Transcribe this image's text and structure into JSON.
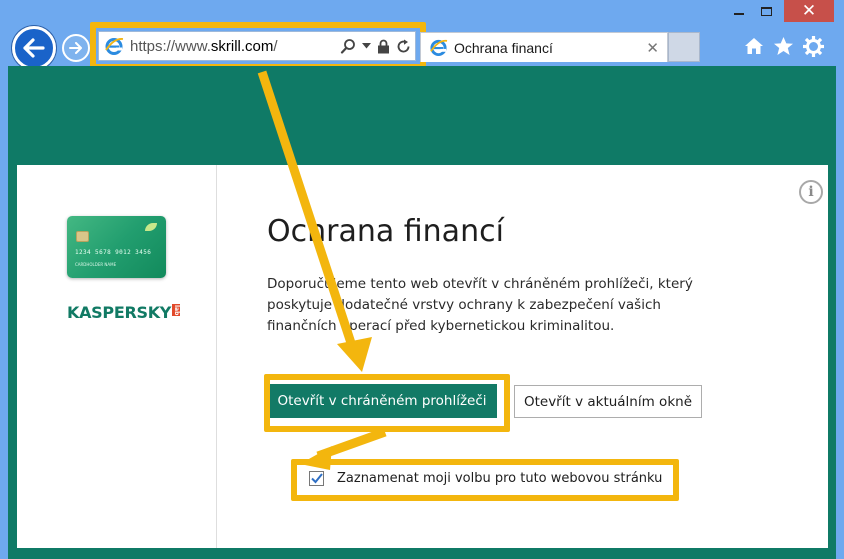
{
  "browser": {
    "address": {
      "scheme": "https://",
      "prefix": "www.",
      "domain": "skrill.com",
      "suffix": "/"
    },
    "tab": {
      "title": "Ochrana financí"
    },
    "window_controls": {
      "close_glyph": "✕"
    }
  },
  "dialog": {
    "title": "Ochrana financí",
    "description": "Doporučujeme tento web otevřít v chráněném prohlížeči, který poskytuje dodatečné vrstvy ochrany k zabezpečení vašich finančních operací před kybernetickou kriminalitou.",
    "primary_button": "Otevřít v chráněném prohlížeči",
    "secondary_button": "Otevřít v aktuálním okně",
    "remember_checkbox": {
      "label": "Zaznamenat moji volbu pro tuto webovou stránku",
      "checked": true
    },
    "info_glyph": "i"
  },
  "branding": {
    "name": "KASPERSKY",
    "lab": "lab",
    "card_number": "1234 5678 9012 3456",
    "card_holder": "CARDHOLDER NAME"
  },
  "colors": {
    "page_green": "#0f7a66",
    "highlight": "#f3b60e",
    "brand_red": "#e24a2b"
  }
}
